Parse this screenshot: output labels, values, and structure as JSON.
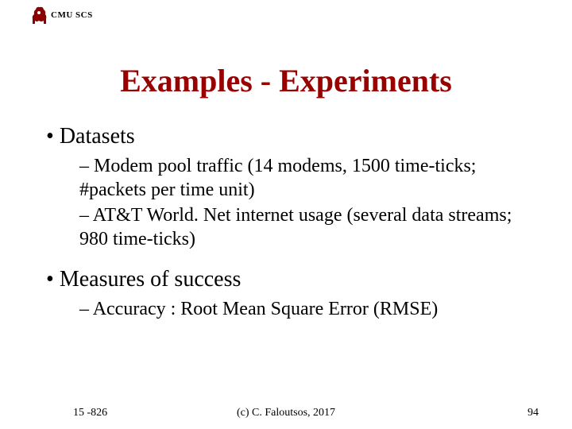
{
  "header": {
    "org": "CMU SCS"
  },
  "title": "Examples - Experiments",
  "bullets": {
    "b1": "Datasets",
    "b1_sub1": "Modem pool traffic (14 modems, 1500 time-ticks; #packets per time unit)",
    "b1_sub2": "AT&T World. Net internet usage (several data streams; 980 time-ticks)",
    "b2": "Measures of success",
    "b2_sub1": "Accuracy : Root Mean Square Error (RMSE)"
  },
  "footer": {
    "course": "15 -826",
    "copyright": "(c) C. Faloutsos, 2017",
    "page": "94"
  },
  "colors": {
    "title": "#990000",
    "logo": "#8b0000"
  }
}
